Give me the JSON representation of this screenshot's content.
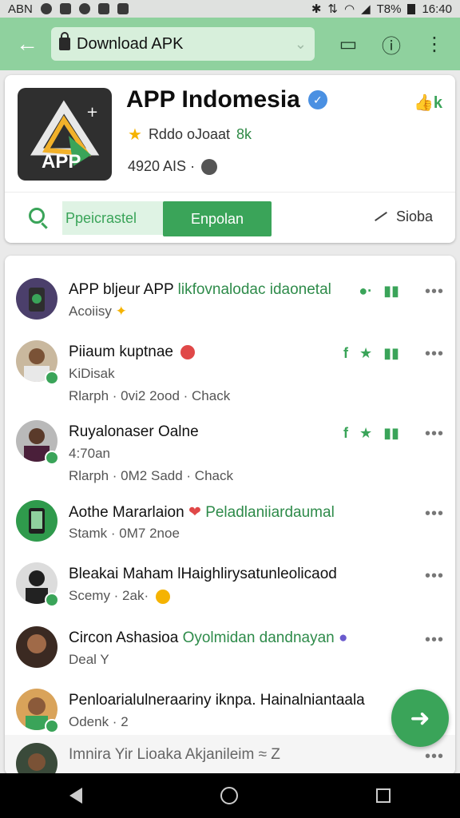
{
  "status_bar": {
    "carrier": "ABN",
    "battery_text": "T8%",
    "time": "16:40"
  },
  "toolbar": {
    "url_text": "Download  APK"
  },
  "app_card": {
    "name": "APP Indomesia",
    "logo_text": "APP",
    "rating_text": "Rddo oJoaat",
    "rating_count": "8k",
    "meta": "4920 AIS ·",
    "corner_icon_text": "k",
    "tab_preview": "Ppeicrastel",
    "tab_download": "Enpolan",
    "share_label": "Sioba"
  },
  "feed": [
    {
      "title": "APP bljeur APP",
      "title_green": "likfovnalodac idaonetal",
      "sub": "Acoiisy",
      "sub2": ""
    },
    {
      "title": "Piiaum kuptnae",
      "title_green": "",
      "sub": "KiDisak",
      "sub2": "Rlarph · 0vi2 2ood · Chack"
    },
    {
      "title": "Ruyalonaser Oalne",
      "title_green": "",
      "sub": "4:70an",
      "sub2": "Rlarph · 0M2 Sadd · Chack"
    },
    {
      "title": "Aothe Mararlaion",
      "title_green": "Peladlaniiardaumal",
      "sub": "Stamk · 0M7 2noe",
      "sub2": ""
    },
    {
      "title": "Bleakai Maham lHaighlirysatunleolicaod",
      "title_green": "",
      "sub": "Scemy · 2ak·",
      "sub2": ""
    },
    {
      "title": "Circon Ashasioa",
      "title_green": "Oyolmidan dandnayan",
      "sub": "Deal Y",
      "sub2": ""
    },
    {
      "title": "Penloarialulneraariny iknpa. Hainalniantaala",
      "title_green": "",
      "sub": "Odenk · 2",
      "sub2": ""
    },
    {
      "title": "Imnira Yir Lioaka Akjanileim ≈ Z",
      "title_green": "",
      "sub": "",
      "sub2": ""
    }
  ],
  "colors": {
    "accent": "#3aa459",
    "toolbar": "#8fd19e",
    "verified": "#4a90e2"
  }
}
